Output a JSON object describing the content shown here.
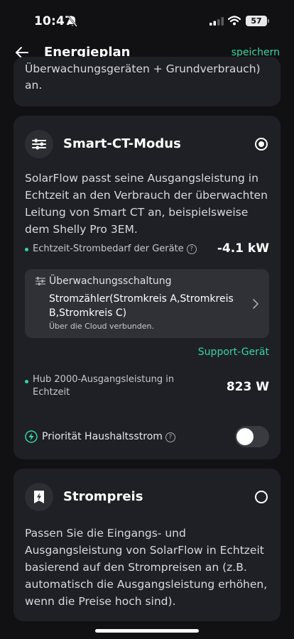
{
  "status_bar": {
    "time": "10:47",
    "battery": "57"
  },
  "header": {
    "title": "Energieplan",
    "save_label": "speichern"
  },
  "top_card": {
    "text": "Überwachungsgeräten + Grundverbrauch) an."
  },
  "smart_ct": {
    "title": "Smart-CT-Modus",
    "selected": true,
    "description": "SolarFlow passt seine Ausgangsleistung in Echtzeit an den Verbrauch der überwachten Leitung von Smart CT an, beispielsweise dem Shelly Pro 3EM.",
    "demand_label": "Echtzeit-Strombedarf der Geräte",
    "demand_value": "-4.1 kW",
    "monitor": {
      "label": "Überwachungsschaltung",
      "value": "Stromzähler(Stromkreis A,Stromkreis B,Stromkreis C)",
      "sub": "Über die Cloud verbunden."
    },
    "support_label": "Support-Gerät",
    "output_label": "Hub 2000-Ausgangsleistung in Echtzeit",
    "output_value": "823 W",
    "priority_label": "Priorität Haushaltsstrom",
    "priority_enabled": false
  },
  "strompreis": {
    "title": "Strompreis",
    "selected": false,
    "description": "Passen Sie die Eingangs- und Ausgangsleistung von SolarFlow in Echtzeit basierend auf den Strompreisen an (z.B. automatisch die Ausgangsleistung erhöhen, wenn die Preise hoch sind)."
  },
  "colors": {
    "accent": "#35d6a4",
    "card": "#1f2025",
    "background": "#111114"
  },
  "icons": [
    "bell-off-icon",
    "signal-icon",
    "wifi-icon",
    "battery-icon",
    "back-arrow-icon",
    "sliders-icon",
    "help-icon",
    "chevron-right-icon",
    "bolt-icon",
    "price-tag-icon"
  ]
}
